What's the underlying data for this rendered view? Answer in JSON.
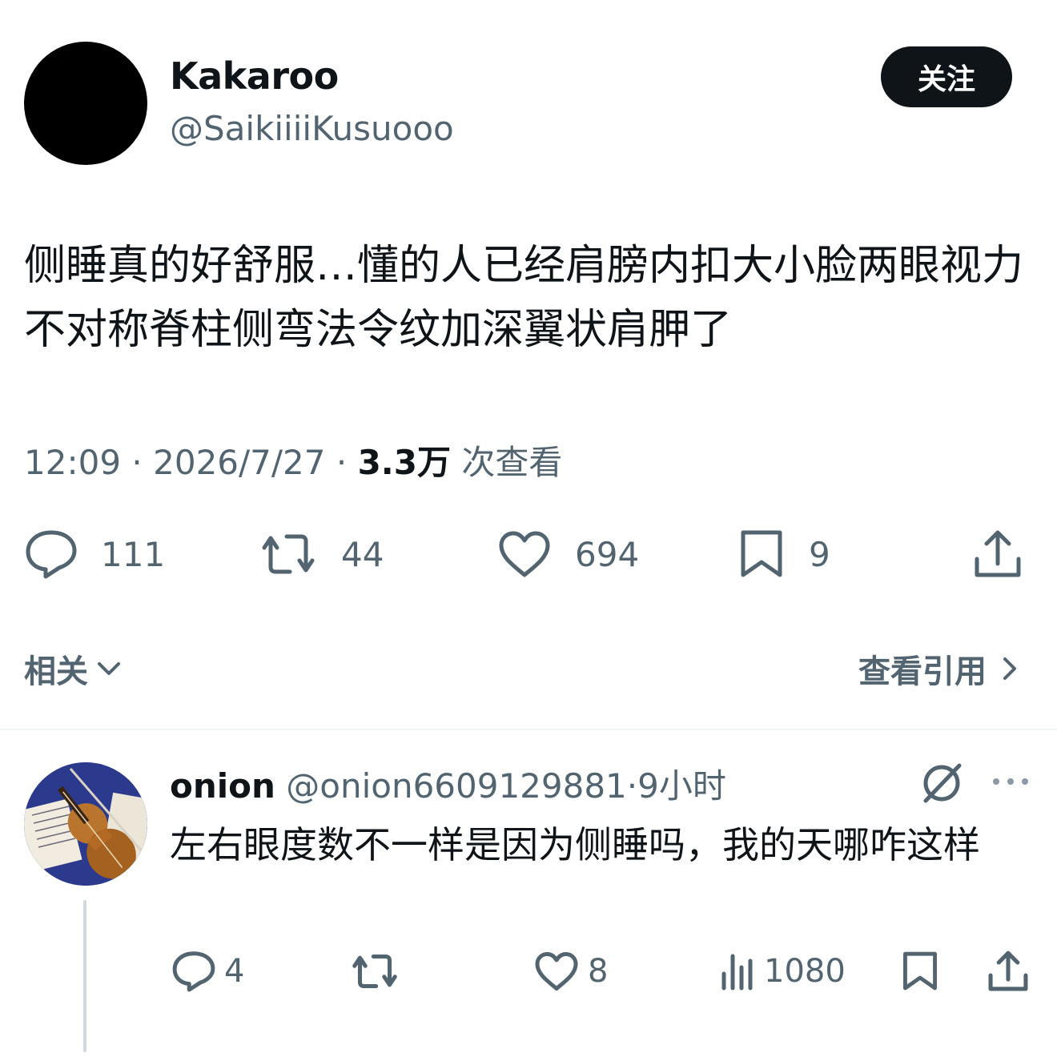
{
  "post": {
    "author_name": "Kakaroo",
    "author_handle": "@SaikiiiiKusuooo",
    "follow_label": "关注",
    "text": "侧睡真的好舒服…懂的人已经肩膀内扣大小脸两眼视力不对称脊柱侧弯法令纹加深翼状肩胛了",
    "time": "12:09",
    "sep": "·",
    "date": "2026/7/27",
    "views": "3.3万",
    "views_label": "次查看",
    "actions": {
      "replies": "111",
      "reposts": "44",
      "likes": "694",
      "bookmarks": "9"
    },
    "icons": [
      "reply-icon",
      "repost-icon",
      "like-icon",
      "bookmark-icon",
      "share-icon"
    ]
  },
  "tabs": {
    "related": "相关",
    "view_quotes": "查看引用"
  },
  "reply": {
    "name": "onion",
    "handle": "@onion6609129881",
    "sep": "·",
    "time": "9小时",
    "text": "左右眼度数不一样是因为侧睡吗，我的天哪咋这样",
    "actions": {
      "replies": "4",
      "likes": "8",
      "views": "1080"
    },
    "icons": [
      "grok-icon",
      "more-icon",
      "reply-icon",
      "repost-icon",
      "like-icon",
      "views-icon",
      "bookmark-icon",
      "share-icon"
    ]
  },
  "colors": {
    "text": "#0f1419",
    "secondary": "#536471",
    "divider": "#eff3f4",
    "button_bg": "#0f1419"
  }
}
